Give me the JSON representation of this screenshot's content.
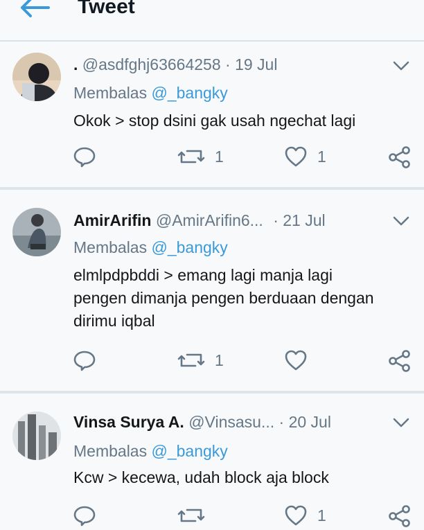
{
  "header": {
    "title": "Tweet"
  },
  "tweets": [
    {
      "display_name": ".",
      "handle": "@asdfghj63664258",
      "date": "· 19 Jul",
      "reply_label": "Membalas",
      "reply_to": "@_bangky",
      "text": "Okok > stop dsini gak usah ngechat lagi",
      "retweets": "1",
      "likes": "1"
    },
    {
      "display_name": "AmirArifin",
      "handle": "@AmirArifin6...",
      "date": "· 21 Jul",
      "reply_label": "Membalas",
      "reply_to": "@_bangky",
      "text": "elmlpdpbddi > emang lagi manja lagi pengen dimanja pengen berduaan dengan dirimu iqbal",
      "retweets": "1",
      "likes": ""
    },
    {
      "display_name": "Vinsa Surya A.",
      "handle": "@Vinsasu...",
      "date": "· 20 Jul",
      "reply_label": "Membalas",
      "reply_to": "@_bangky",
      "text": "Kcw > kecewa, udah block aja block",
      "retweets": "",
      "likes": "1"
    }
  ],
  "colors": {
    "accent": "#3a9ad9",
    "icon": "#657786",
    "divider": "#dde5ea"
  }
}
